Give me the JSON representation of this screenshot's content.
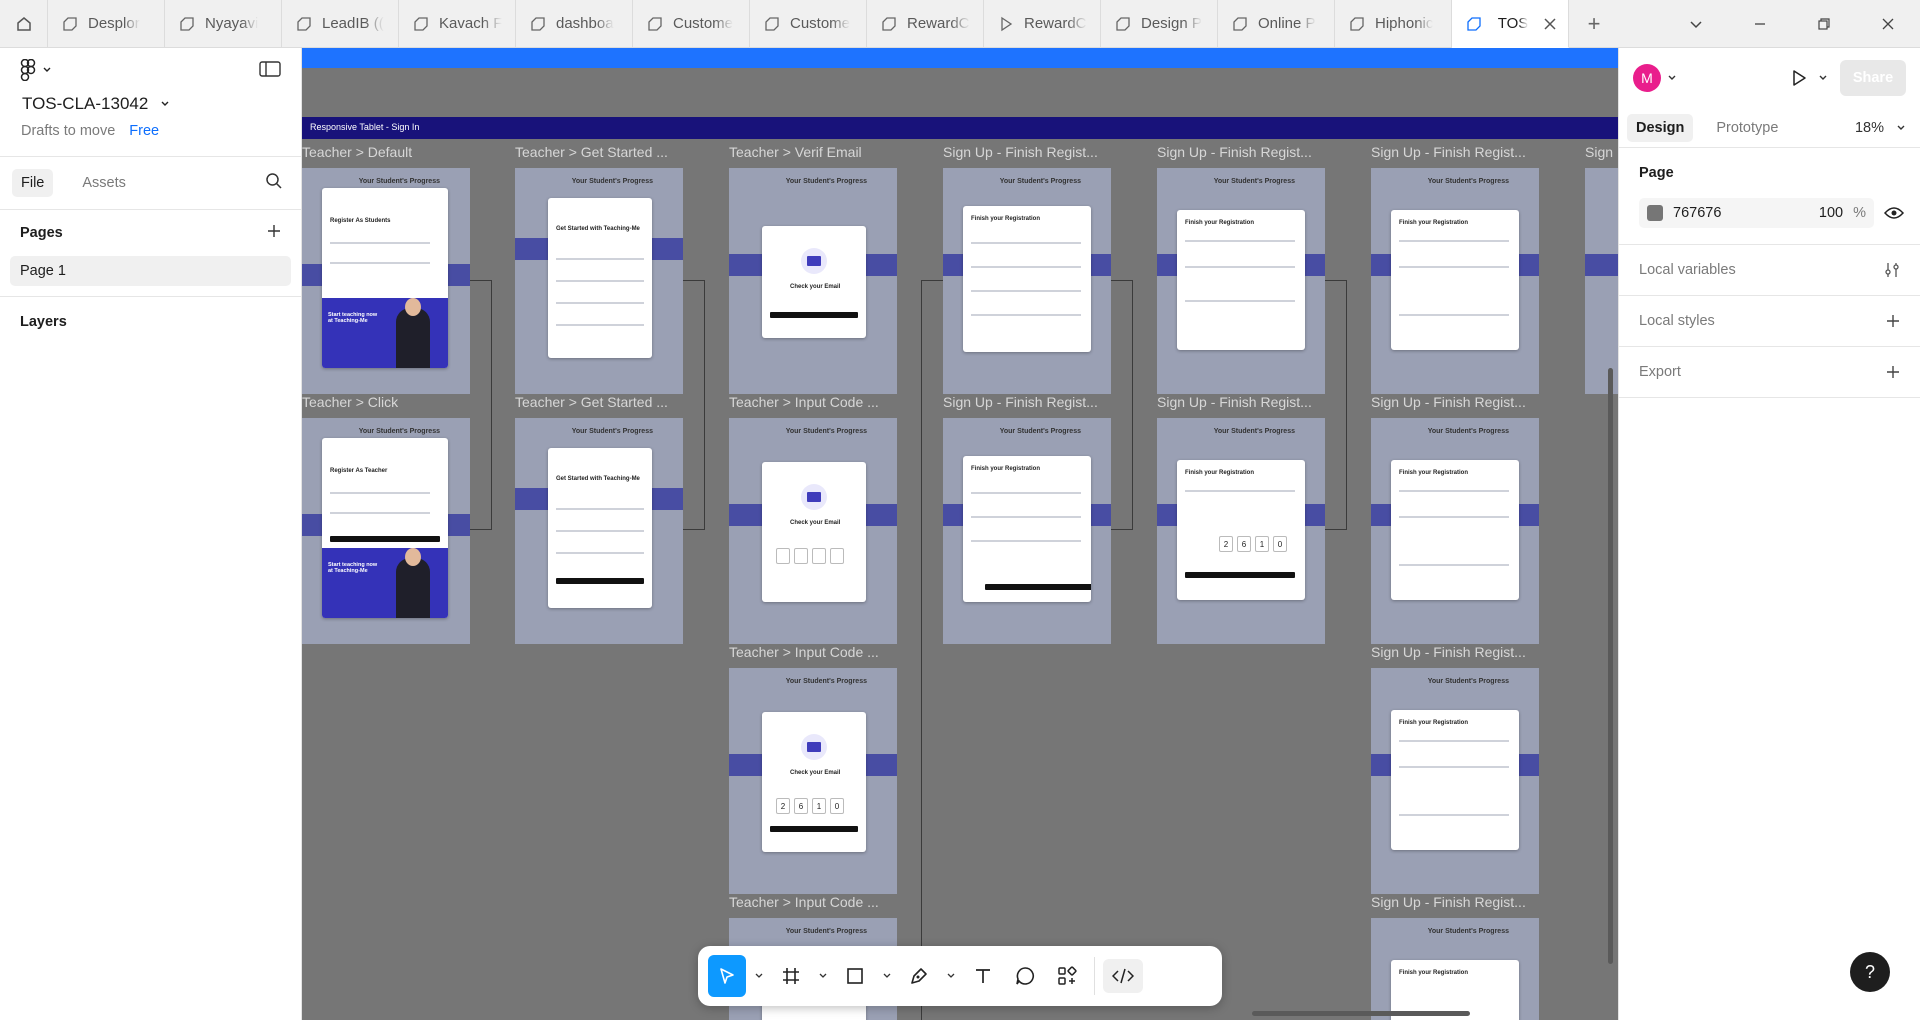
{
  "tabs": [
    {
      "label": "Desplor"
    },
    {
      "label": "Nyayavi"
    },
    {
      "label": "LeadIB (("
    },
    {
      "label": "Kavach F"
    },
    {
      "label": "dashboa"
    },
    {
      "label": "Custome"
    },
    {
      "label": "Custome"
    },
    {
      "label": "RewardC"
    },
    {
      "label": "RewardC"
    },
    {
      "label": "Design P"
    },
    {
      "label": "Online P"
    },
    {
      "label": "Hiphonic"
    },
    {
      "label": "TOS"
    }
  ],
  "file": {
    "name": "TOS-CLA-13042",
    "location": "Drafts to move",
    "plan": "Free"
  },
  "left_tabs": {
    "file": "File",
    "assets": "Assets"
  },
  "pages": {
    "heading": "Pages",
    "items": [
      "Page 1"
    ]
  },
  "layers": {
    "heading": "Layers"
  },
  "canvas": {
    "section_title": "Responsive Tablet - Sign In",
    "frame_labels": {
      "r1c1": "Teacher > Default",
      "r1c2": "Teacher > Get Started ...",
      "r1c3": "Teacher > Verif Email",
      "r1c4": "Sign Up - Finish Regist...",
      "r1c5": "Sign Up - Finish Regist...",
      "r1c6": "Sign Up - Finish Regist...",
      "r1c7": "Sign",
      "r2c1": "Teacher > Click",
      "r2c2": "Teacher > Get Started ...",
      "r2c3": "Teacher > Input Code ...",
      "r2c4": "Sign Up - Finish Regist...",
      "r2c5": "Sign Up - Finish Regist...",
      "r2c6": "Sign Up - Finish Regist...",
      "r3c3": "Teacher > Input Code ...",
      "r3c6": "Sign Up - Finish Regist...",
      "r4c3": "Teacher > Input Code ...",
      "r4c6": "Sign Up - Finish Regist..."
    },
    "mock": {
      "progress_header": "Your Student's Progress",
      "register_students": "Register As Students",
      "register_teacher": "Register As Teacher",
      "promo": "Start teaching now at Teaching-Me",
      "get_started": "Get Started with Teaching-Me",
      "check_email": "Check your Email",
      "finish_registration": "Finish your Registration",
      "code_digits": [
        "2",
        "6",
        "1",
        "0"
      ]
    }
  },
  "right_panel": {
    "avatar_initial": "M",
    "share": "Share",
    "tabs": {
      "design": "Design",
      "prototype": "Prototype"
    },
    "zoom": "18%",
    "page_heading": "Page",
    "background": {
      "hex": "767676",
      "opacity": "100",
      "unit": "%"
    },
    "local_variables": "Local variables",
    "local_styles": "Local styles",
    "export": "Export"
  },
  "help": "?",
  "colors": {
    "canvas_bg": "#767676",
    "accent": "#0d99ff",
    "section_bar": "#18127a",
    "avatar": "#e91e8c"
  }
}
